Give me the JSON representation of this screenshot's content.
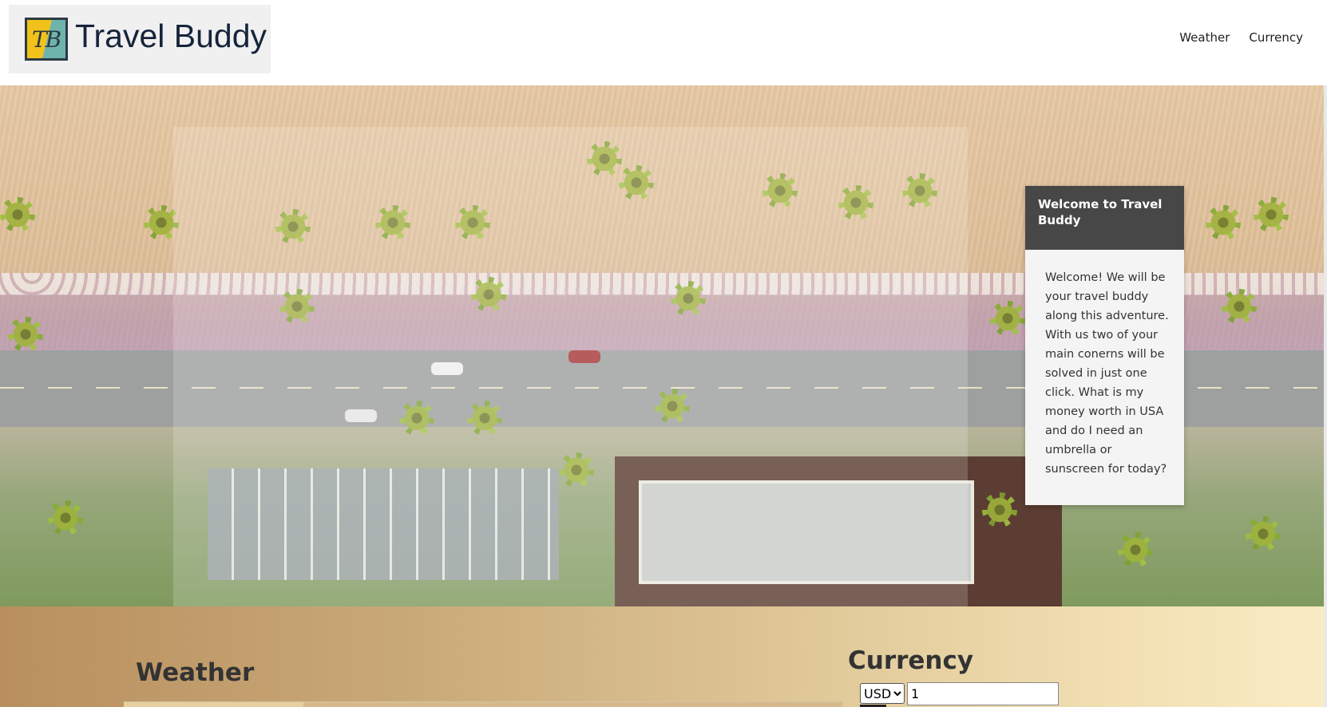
{
  "header": {
    "logo_text": "TB",
    "brand_name": "Travel Buddy",
    "nav": [
      {
        "label": "Weather"
      },
      {
        "label": "Currency"
      }
    ]
  },
  "hero": {
    "image_icon": "beach-aerial-image"
  },
  "welcome": {
    "title": "Welcome to Travel Buddy",
    "body": "Welcome! We will be your travel buddy along this adventure. With us two of your main conerns will be solved in just one click. What is my money worth in USA and do I need an umbrella or sunscreen for today?"
  },
  "weather": {
    "title": "Weather"
  },
  "currency": {
    "title": "Currency",
    "selected": "USD",
    "amount": "1"
  },
  "colors": {
    "card_header": "#474747",
    "card_body": "#f4f4f4",
    "brand_text": "#16243a"
  }
}
